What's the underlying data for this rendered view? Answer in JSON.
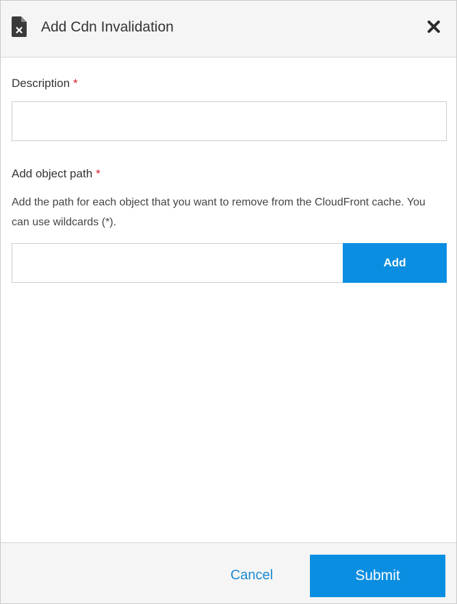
{
  "dialog": {
    "title": "Add Cdn Invalidation",
    "icon": "file-x-icon",
    "close_icon": "close-icon"
  },
  "description": {
    "label": "Description",
    "required_mark": "*",
    "value": "",
    "placeholder": ""
  },
  "object_path": {
    "label": "Add object path",
    "required_mark": "*",
    "help_text": "Add the path for each object that you want to remove from the CloudFront cache. You can use wildcards (*).",
    "value": "",
    "placeholder": "",
    "add_label": "Add"
  },
  "footer": {
    "cancel_label": "Cancel",
    "submit_label": "Submit"
  },
  "colors": {
    "accent": "#0a8ee2",
    "link": "#1a8bd1",
    "required": "#d0202e",
    "header_bg": "#f5f5f5"
  }
}
